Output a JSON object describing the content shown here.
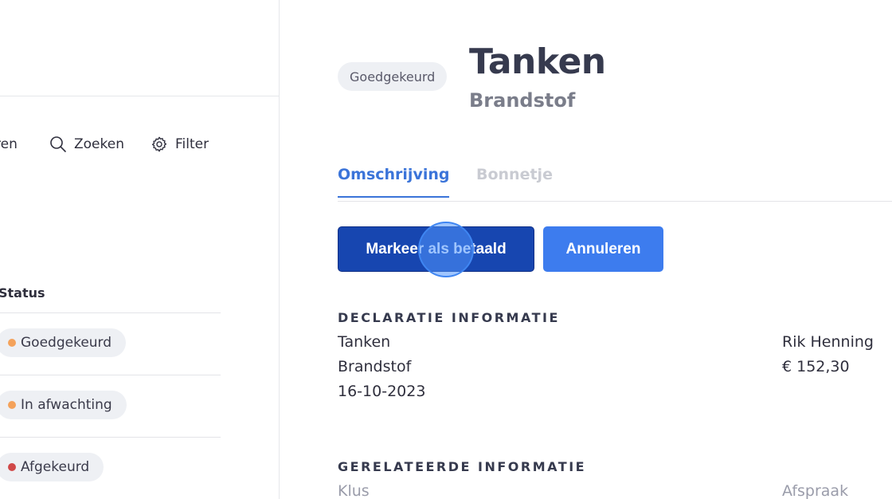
{
  "toolbar": {
    "partial_label": "ren",
    "search_label": "Zoeken",
    "filter_label": "Filter"
  },
  "status_list": {
    "header": "Status",
    "items": [
      {
        "label": "Goedgekeurd",
        "dot_color": "#f4a25b"
      },
      {
        "label": "In afwachting",
        "dot_color": "#f4a25b"
      },
      {
        "label": "Afgekeurd",
        "dot_color": "#d04848"
      }
    ]
  },
  "detail": {
    "badge": "Goedgekeurd",
    "title": "Tanken",
    "subtitle": "Brandstof",
    "tabs": [
      {
        "label": "Omschrijving",
        "active": true
      },
      {
        "label": "Bonnetje",
        "active": false
      }
    ],
    "actions": {
      "primary_label": "Markeer als betaald",
      "secondary_label": "Annuleren"
    },
    "declaration": {
      "heading": "DECLARATIE INFORMATIE",
      "name": "Tanken",
      "category": "Brandstof",
      "date": "16-10-2023",
      "person": "Rik Henning",
      "amount": "€ 152,30"
    },
    "related": {
      "heading": "GERELATEERDE INFORMATIE",
      "left_label": "Klus",
      "right_label": "Afspraak"
    }
  },
  "colors": {
    "accent": "#3b74d9",
    "primary_button": "#1746b0",
    "secondary_button": "#3d7cee",
    "pill_bg": "#eef0f4"
  }
}
